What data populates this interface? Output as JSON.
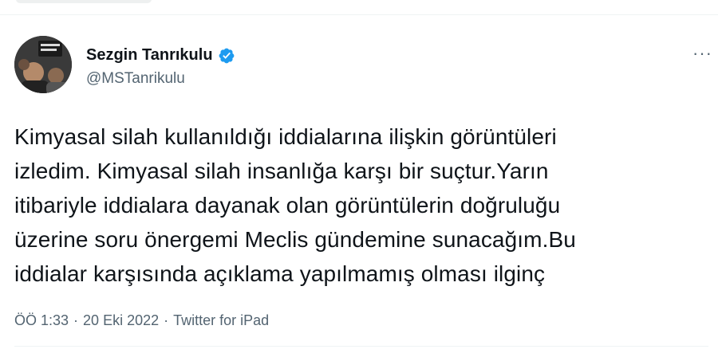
{
  "author": {
    "display_name": "Sezgin Tanrıkulu",
    "handle": "@MSTanrikulu",
    "verified": true,
    "verified_color": "#1d9bf0"
  },
  "tweet": {
    "text": "Kimyasal silah kullanıldığı iddialarına ilişkin  görüntüleri\nizledim. Kimyasal silah insanlığa karşı bir suçtur.Yarın\nitibariyle iddialara dayanak olan görüntülerin doğruluğu\nüzerine soru önergemi Meclis gündemine sunacağım.Bu\niddialar karşısında açıklama yapılmamış olması ilginç"
  },
  "meta": {
    "time": "ÖÖ 1:33",
    "separator": "·",
    "date": "20 Eki 2022",
    "source": "Twitter for iPad"
  },
  "icons": {
    "more": "more-options-icon",
    "verified": "verified-badge-icon"
  },
  "colors": {
    "text_primary": "#0f1419",
    "text_secondary": "#536471",
    "background": "#ffffff"
  }
}
